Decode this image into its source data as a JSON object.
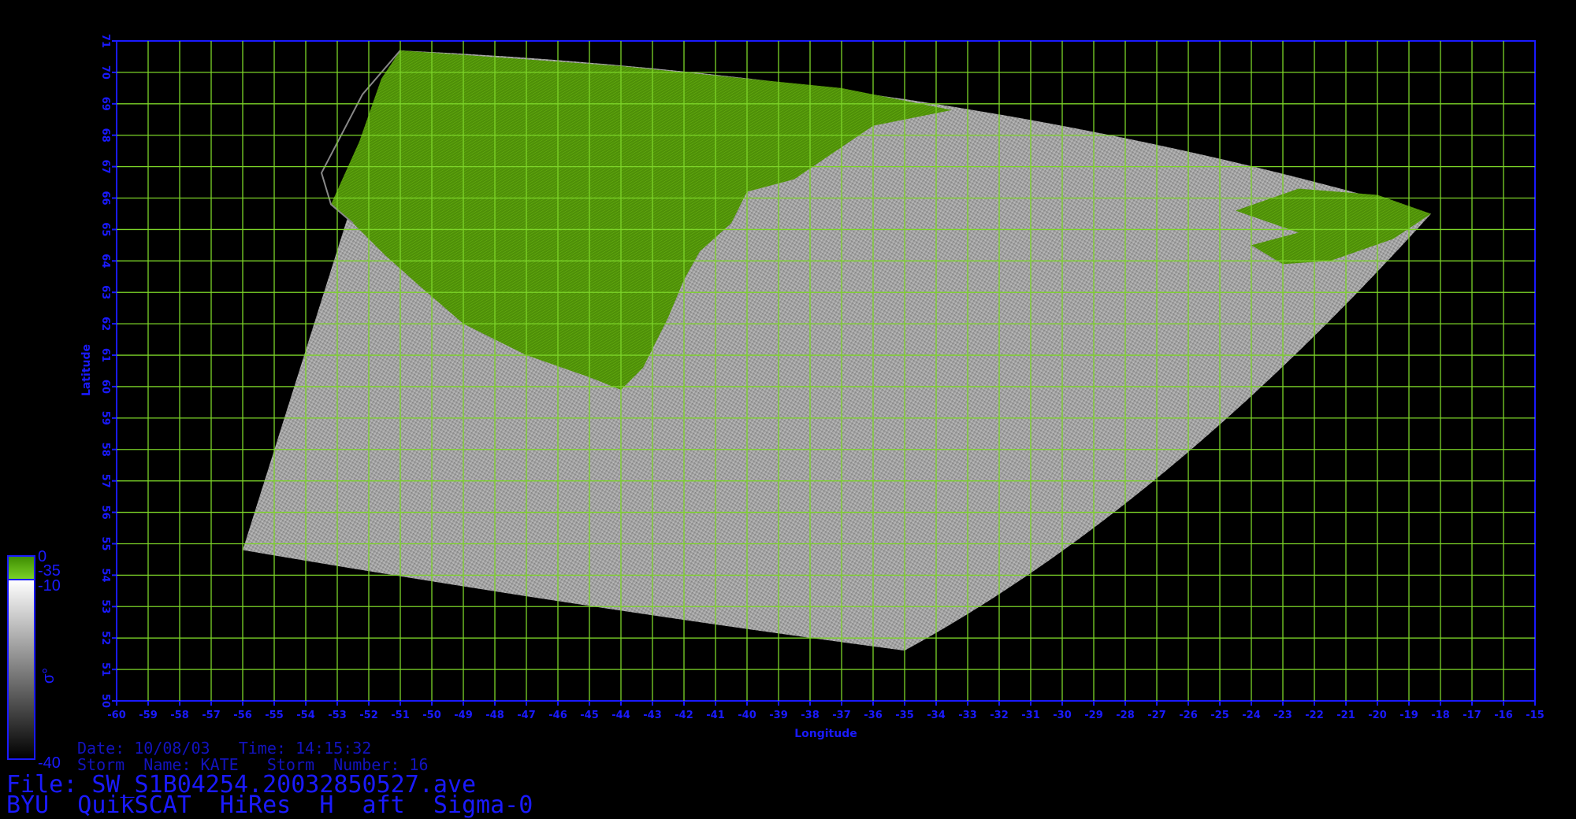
{
  "map": {
    "x_axis_label": "Longitude",
    "y_axis_label": "Latitude",
    "lon_range": [
      -60,
      -15
    ],
    "lat_range": [
      50,
      71
    ],
    "lon_ticks": [
      "-60",
      "-59",
      "-58",
      "-57",
      "-56",
      "-55",
      "-54",
      "-53",
      "-52",
      "-51",
      "-50",
      "-49",
      "-48",
      "-47",
      "-46",
      "-45",
      "-44",
      "-43",
      "-42",
      "-41",
      "-40",
      "-39",
      "-38",
      "-37",
      "-36",
      "-35",
      "-34",
      "-33",
      "-32",
      "-31",
      "-30",
      "-29",
      "-28",
      "-27",
      "-26",
      "-25",
      "-24",
      "-23",
      "-22",
      "-21",
      "-20",
      "-19",
      "-18",
      "-17",
      "-16",
      "-15"
    ],
    "lat_ticks": [
      "50",
      "51",
      "52",
      "53",
      "54",
      "55",
      "56",
      "57",
      "58",
      "59",
      "60",
      "61",
      "62",
      "63",
      "64",
      "65",
      "66",
      "67",
      "68",
      "69",
      "70",
      "71"
    ],
    "swath_corners": [
      {
        "lon": -56.0,
        "lat": 54.8
      },
      {
        "lon": -35.0,
        "lat": 51.6
      },
      {
        "lon": -18.3,
        "lat": 65.5
      },
      {
        "lon": -51.0,
        "lat": 70.7
      }
    ],
    "colors": {
      "land": "#5a9e0a",
      "grid": "#7cd428",
      "axis": "#1a1aff",
      "background": "#000000"
    }
  },
  "colorbar": {
    "label": "σ°",
    "top_value": "0",
    "land_split_value": "-35",
    "ocean_top_value": "-10",
    "bottom_value": "-40"
  },
  "info": {
    "date_line": "Date: 10/08/03   Time: 14:15:32",
    "storm_line": "Storm  Name: KATE   Storm  Number: 16",
    "file_line": "File: SW_S1B04254.20032850527.ave",
    "title_line": "BYU  QuikSCAT  HiRes  H  aft  Sigma-0"
  }
}
